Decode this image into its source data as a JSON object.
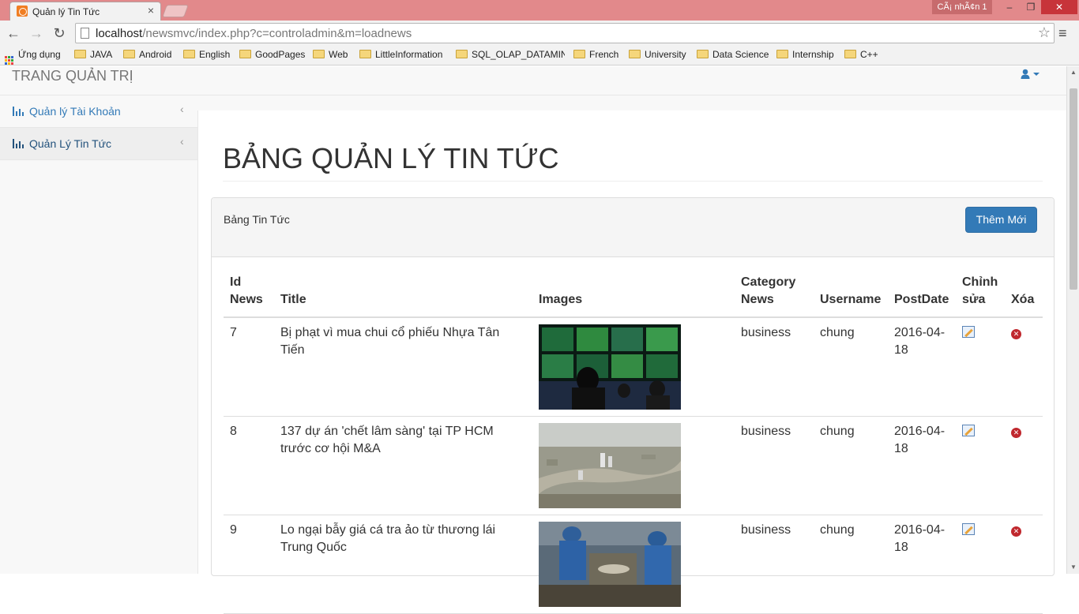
{
  "browser": {
    "tab_title": "Quản lý Tin Tức",
    "tab_close": "×",
    "user_badge": "CÃ¡ nhÃ¢n 1",
    "win_min": "–",
    "win_max": "❐",
    "win_close": "✕",
    "url_host": "localhost",
    "url_path": "/newsmvc/index.php?c=controladmin&m=loadnews",
    "bookmarks": [
      "Ứng dụng",
      "JAVA",
      "Android",
      "English",
      "GoodPages",
      "Web",
      "LittleInformation",
      "SQL_OLAP_DATAMIN",
      "French",
      "University",
      "Data Science",
      "Internship",
      "C++"
    ]
  },
  "navbar": {
    "brand": "TRANG QUẢN TRỊ"
  },
  "sidebar": {
    "items": [
      {
        "label": "Quản lý Tài Khoản"
      },
      {
        "label": "Quản Lý Tin Tức"
      }
    ]
  },
  "main": {
    "page_title": "BẢNG QUẢN LÝ TIN TỨC",
    "panel_title": "Bảng Tin Tức",
    "add_button": "Thêm Mới",
    "columns": {
      "id_line1": "Id",
      "id_line2": "News",
      "title": "Title",
      "images": "Images",
      "category_line1": "Category",
      "category_line2": "News",
      "username": "Username",
      "postdate": "PostDate",
      "edit_line1": "Chỉnh",
      "edit_line2": "sửa",
      "delete": "Xóa"
    },
    "rows": [
      {
        "id": "7",
        "title": "Bị phạt vì mua chui cổ phiếu Nhựa Tân Tiến",
        "image": "stock-board-photo",
        "category": "business",
        "username": "chung",
        "postdate_line1": "2016-04-",
        "postdate_line2": "18"
      },
      {
        "id": "8",
        "title": "137 dự án 'chết lâm sàng' tại TP HCM trước cơ hội M&A",
        "image": "city-aerial-photo",
        "category": "business",
        "username": "chung",
        "postdate_line1": "2016-04-",
        "postdate_line2": "18"
      },
      {
        "id": "9",
        "title": "Lo ngại bẫy giá cá tra ảo từ thương lái Trung Quốc",
        "image": "fish-market-photo",
        "category": "business",
        "username": "chung",
        "postdate_line1": "2016-04-",
        "postdate_line2": "18"
      }
    ]
  },
  "colors": {
    "primary": "#337ab7",
    "titlebar": "#e2898b",
    "delete": "#c0282e"
  }
}
